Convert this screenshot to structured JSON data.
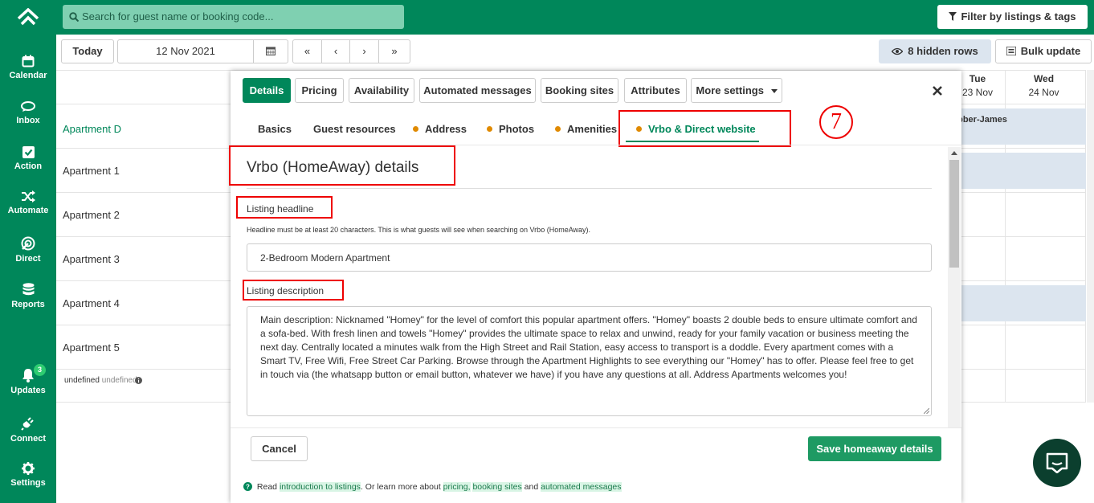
{
  "sidebar": {
    "items": [
      {
        "label": "Calendar",
        "icon": "calendar-icon"
      },
      {
        "label": "Inbox",
        "icon": "chat-icon"
      },
      {
        "label": "Action",
        "icon": "checkbox-icon"
      },
      {
        "label": "Automate",
        "icon": "shuffle-icon"
      },
      {
        "label": "Direct",
        "icon": "direct-icon"
      },
      {
        "label": "Reports",
        "icon": "database-icon"
      },
      {
        "label": "Updates",
        "icon": "bell-icon",
        "badge": "3"
      },
      {
        "label": "Connect",
        "icon": "plug-icon"
      },
      {
        "label": "Settings",
        "icon": "gear-icon"
      }
    ]
  },
  "topbar": {
    "search_placeholder": "Search for guest name or booking code...",
    "filter_label": "Filter by listings & tags"
  },
  "toolbar": {
    "today": "Today",
    "date": "12 Nov 2021",
    "first": "«",
    "prev": "‹",
    "next": "›",
    "last": "»",
    "hidden_rows": "8 hidden rows",
    "bulk_update": "Bulk update"
  },
  "calendar": {
    "days": [
      {
        "dow": "Tue",
        "date": "23 Nov"
      },
      {
        "dow": "Wed",
        "date": "24 Nov"
      }
    ],
    "rows": [
      {
        "label": "Apartment D",
        "highlight": true
      },
      {
        "label": "Apartment 1"
      },
      {
        "label": "Apartment 2"
      },
      {
        "label": "Apartment 3"
      },
      {
        "label": "Apartment 4"
      },
      {
        "label": "Apartment 5"
      }
    ],
    "undefined_row": {
      "a": "undefined",
      "b": "undefined"
    },
    "booking_guest": "ebber-James"
  },
  "modal": {
    "tabs": [
      "Details",
      "Pricing",
      "Availability",
      "Automated messages",
      "Booking sites",
      "Attributes",
      "More settings"
    ],
    "subtabs": [
      "Basics",
      "Guest resources",
      "Address",
      "Photos",
      "Amenities",
      "Vrbo & Direct website"
    ],
    "annotation": "7",
    "section_title": "Vrbo (HomeAway) details",
    "headline_label": "Listing headline",
    "headline_help": "Headline must be at least 20 characters. This is what guests will see when searching on Vrbo (HomeAway).",
    "headline_value": "2-Bedroom Modern Apartment",
    "description_label": "Listing description",
    "description_value": "Main description: Nicknamed \"Homey\" for the level of comfort this popular apartment offers. \"Homey\" boasts 2 double beds to ensure ultimate comfort and a sofa-bed. With fresh linen and towels \"Homey\" provides the ultimate space to relax and unwind, ready for your family vacation or business meeting the next day. Centrally located a minutes walk from the High Street and Rail Station, easy access to transport is a doddle. Every apartment comes with a Smart TV, Free Wifi, Free Street Car Parking. Browse through the Apartment Highlights to see everything our \"Homey\" has to offer. Please feel free to get in touch via (the whatsapp button or email button, whatever we have) if you have any questions at all. Address Apartments welcomes you!",
    "cancel": "Cancel",
    "save": "Save homeaway details",
    "help": {
      "read": "Read",
      "intro_link": "introduction to listings",
      "middle": ". Or learn more about",
      "pricing_link": "pricing",
      "booking_sites_link": "booking sites",
      "and": "and",
      "automated_link": "automated messages"
    }
  },
  "colors": {
    "brand": "#00875a",
    "annotation": "#e00000",
    "booking": "#dce5ef"
  }
}
